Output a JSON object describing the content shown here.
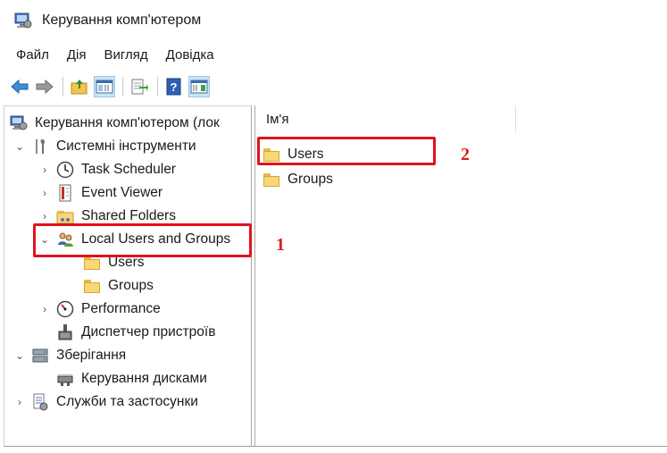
{
  "window": {
    "title": "Керування комп'ютером"
  },
  "menu": [
    "Файл",
    "Дія",
    "Вигляд",
    "Довідка"
  ],
  "tree": {
    "root": "Керування комп'ютером (лок",
    "system_tools": "Системні інструменти",
    "task_scheduler": "Task Scheduler",
    "event_viewer": "Event Viewer",
    "shared_folders": "Shared Folders",
    "local_users_groups": "Local Users and Groups",
    "users": "Users",
    "groups": "Groups",
    "performance": "Performance",
    "device_manager": "Диспетчер пристроїв",
    "storage": "Зберігання",
    "disk_management": "Керування дисками",
    "services": "Служби та застосунки"
  },
  "list": {
    "column_name": "Ім'я",
    "items": [
      "Users",
      "Groups"
    ]
  },
  "annotations": {
    "label_1": "1",
    "label_2": "2"
  },
  "colors": {
    "highlight": "#e0131c",
    "annotation": "#d61f1f",
    "folder": "#f8d775"
  }
}
